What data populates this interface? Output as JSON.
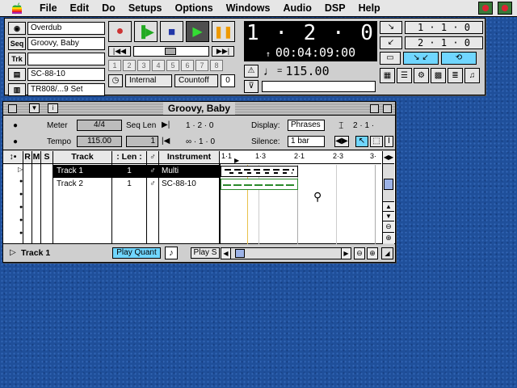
{
  "menubar": {
    "items": [
      "File",
      "Edit",
      "Do",
      "Setups",
      "Options",
      "Windows",
      "Audio",
      "DSP",
      "Help"
    ]
  },
  "transport": {
    "record_mode": "Overdub",
    "sequence": "Groovy, Baby",
    "track": "",
    "device": "SC-88-10",
    "set": "TR808/...9 Set",
    "side_labels": [
      "",
      "Seq",
      "Trk",
      "",
      ""
    ],
    "counter_main": "1 · 2 · 0",
    "counter_time": "00:04:09:00",
    "tempo": "115.00",
    "sync_mode": "Internal",
    "countoff_label": "Countoff",
    "countoff_value": "0",
    "loop_start": "1 · 1 · 0",
    "loop_end": "2 · 1 · 0",
    "num_buttons": [
      "1",
      "2",
      "3",
      "4",
      "5",
      "6",
      "7",
      "8"
    ]
  },
  "track_window": {
    "title": "Groovy, Baby",
    "meter_label": "Meter",
    "meter_value": "4/4",
    "tempo_label": "Tempo",
    "tempo_value": "115.00",
    "seqlen_label": "Seq Len",
    "seqlen_value": "1",
    "pos1": "1 · 2 · 0",
    "pos2": "∞ · 1 · 0",
    "display_label": "Display:",
    "display_value": "Phrases",
    "silence_label": "Silence:",
    "silence_value": "1 bar",
    "zoom_value": "2 · 1 ·",
    "columns": {
      "r": "R",
      "m": "M",
      "s": "S",
      "track": "Track",
      "len": "Len",
      "instrument": "Instrument"
    },
    "tracks": [
      {
        "name": "Track 1",
        "len": "1",
        "instrument": "Multi"
      },
      {
        "name": "Track 2",
        "len": "1",
        "instrument": "SC-88-10"
      }
    ],
    "ruler_marks": [
      "1·1",
      "1·3",
      "2·1",
      "2·3",
      "3·"
    ],
    "footer_track": "Track 1",
    "play_quant": "Play Quant",
    "play_s": "Play S"
  }
}
